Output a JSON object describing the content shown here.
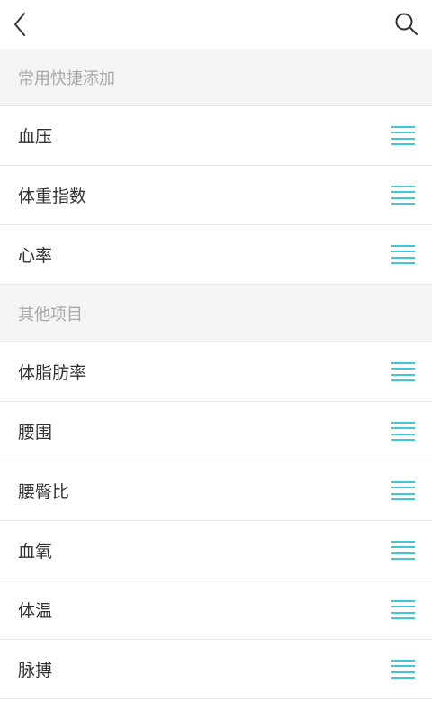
{
  "header": {
    "back_icon": "back-arrow-icon",
    "search_icon": "search-icon"
  },
  "sections": [
    {
      "title": "常用快捷添加",
      "items": [
        "血压",
        "体重指数",
        "心率"
      ]
    },
    {
      "title": "其他项目",
      "items": [
        "体脂肪率",
        "腰围",
        "腰臀比",
        "血氧",
        "体温",
        "脉搏"
      ]
    }
  ],
  "colors": {
    "accent": "#3fc7d8",
    "section_bg": "#f4f4f4",
    "section_text": "#a8a8a8",
    "item_text": "#333333",
    "divider": "#e6e6e6"
  },
  "handle_icon": "drag-handle-icon"
}
